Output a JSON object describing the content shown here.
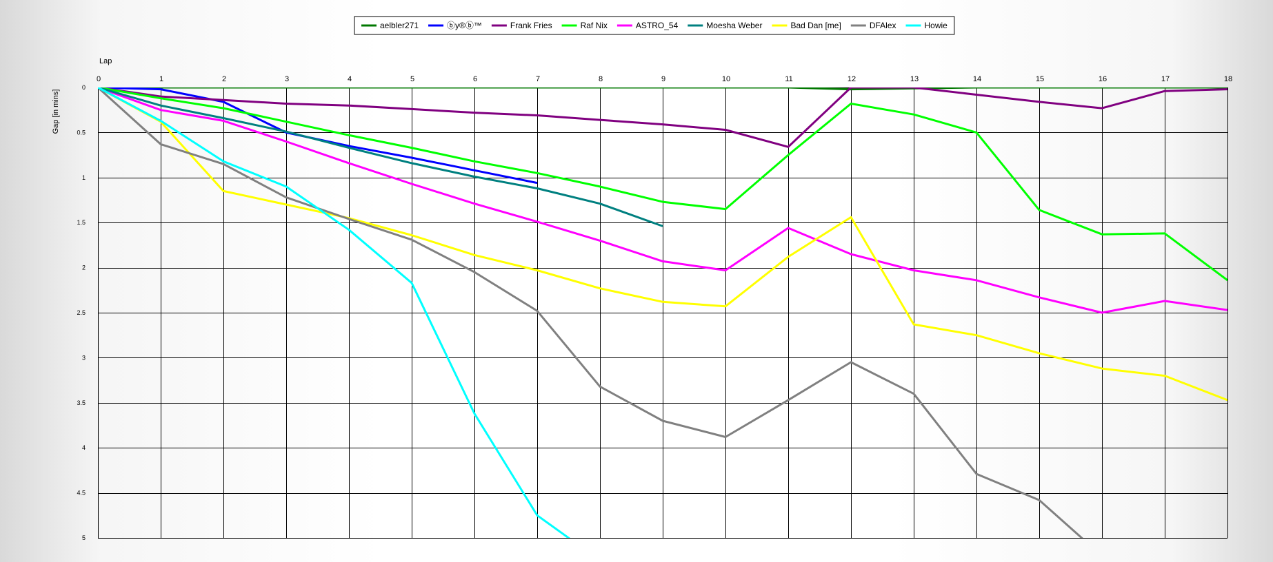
{
  "chart_data": {
    "type": "line",
    "title": "",
    "xlabel": "Lap",
    "ylabel": "Gap [in mins]",
    "x": [
      0,
      1,
      2,
      3,
      4,
      5,
      6,
      7,
      8,
      9,
      10,
      11,
      12,
      13,
      14,
      15,
      16,
      17,
      18
    ],
    "xlim": [
      0,
      18
    ],
    "ylim": [
      0,
      5
    ],
    "y_inverted": true,
    "y_ticks": [
      0,
      0.5,
      1,
      1.5,
      2,
      2.5,
      3,
      3.5,
      4,
      4.5,
      5
    ],
    "y_tick_labels": [
      "0",
      "0.5",
      "1",
      "1.5",
      "2",
      "2.5",
      "3",
      "3.5",
      "4",
      "4.5",
      "5"
    ],
    "x_tick_labels": [
      "0",
      "1",
      "2",
      "3",
      "4",
      "5",
      "6",
      "7",
      "8",
      "9",
      "10",
      "11",
      "12",
      "13",
      "14",
      "15",
      "16",
      "17",
      "18"
    ],
    "grid": true,
    "legend_position": "top",
    "series": [
      {
        "name": "aelbler271",
        "color": "#007800",
        "values": [
          0,
          0,
          0,
          0,
          0,
          0,
          0,
          0,
          0,
          0,
          0,
          0,
          0.02,
          0.01,
          0,
          0,
          0,
          0,
          0
        ]
      },
      {
        "name": "ⓑу®ⓑ™",
        "color": "#0000ff",
        "values": [
          0,
          0.02,
          0.16,
          0.5,
          0.65,
          0.78,
          0.92,
          1.06
        ]
      },
      {
        "name": "Frank Fries",
        "color": "#800080",
        "values": [
          0,
          0.1,
          0.14,
          0.18,
          0.2,
          0.24,
          0.28,
          0.31,
          0.36,
          0.41,
          0.47,
          0.66,
          0,
          0,
          0.08,
          0.16,
          0.23,
          0.04,
          0.02
        ]
      },
      {
        "name": "Raf Nix",
        "color": "#00ff00",
        "values": [
          0,
          0.12,
          0.23,
          0.38,
          0.53,
          0.67,
          0.82,
          0.95,
          1.1,
          1.27,
          1.35,
          0.75,
          0.18,
          0.3,
          0.5,
          1.36,
          1.63,
          1.62,
          2.14
        ]
      },
      {
        "name": "ASTRO_54",
        "color": "#ff00ff",
        "values": [
          0,
          0.25,
          0.37,
          0.6,
          0.84,
          1.07,
          1.29,
          1.49,
          1.7,
          1.93,
          2.03,
          1.56,
          1.85,
          2.03,
          2.14,
          2.33,
          2.5,
          2.37,
          2.47
        ]
      },
      {
        "name": "Moesha Weber",
        "color": "#008080",
        "values": [
          0,
          0.2,
          0.34,
          0.49,
          0.67,
          0.84,
          0.99,
          1.12,
          1.29,
          1.54
        ]
      },
      {
        "name": "Bad Dan [me]",
        "color": "#ffff00",
        "values": [
          0,
          0.38,
          1.15,
          1.3,
          1.45,
          1.64,
          1.86,
          2.03,
          2.23,
          2.38,
          2.43,
          1.88,
          1.44,
          2.63,
          2.75,
          2.95,
          3.12,
          3.2,
          3.47
        ]
      },
      {
        "name": "DFAlex",
        "color": "#808080",
        "values": [
          0,
          0.63,
          0.85,
          1.22,
          1.46,
          1.69,
          2.05,
          2.48,
          3.32,
          3.7,
          3.88,
          3.47,
          3.05,
          3.4,
          4.29,
          4.58,
          5.2
        ]
      },
      {
        "name": "Howie",
        "color": "#00ffff",
        "values": [
          0,
          0.37,
          0.82,
          1.1,
          1.58,
          2.17,
          3.62,
          4.75,
          5.25
        ]
      }
    ]
  }
}
